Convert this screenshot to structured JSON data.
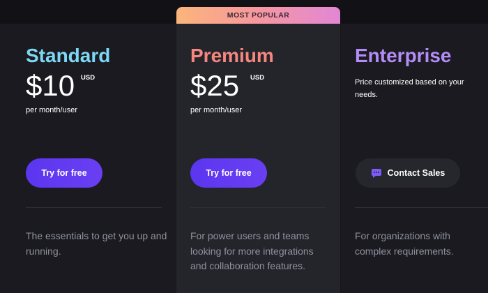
{
  "badge": {
    "label": "MOST POPULAR"
  },
  "plans": [
    {
      "name": "Standard",
      "price": "$10",
      "currency": "USD",
      "period": "per month/user",
      "cta": "Try for free",
      "description": "The essentials to get you up and running.",
      "title_color": "#7dd8f5"
    },
    {
      "name": "Premium",
      "price": "$25",
      "currency": "USD",
      "period": "per month/user",
      "cta": "Try for free",
      "description": "For power users and teams looking for more integrations and collaboration features.",
      "title_color": "#f6877f"
    },
    {
      "name": "Enterprise",
      "note": "Price customized based on your needs.",
      "cta": "Contact Sales",
      "cta_icon": "chat-bubble-icon",
      "description": "For organizations with complex requirements.",
      "title_color": "#b48cf7"
    }
  ],
  "colors": {
    "button_primary": "#5b36f0",
    "chat_icon": "#7b5cf5"
  }
}
